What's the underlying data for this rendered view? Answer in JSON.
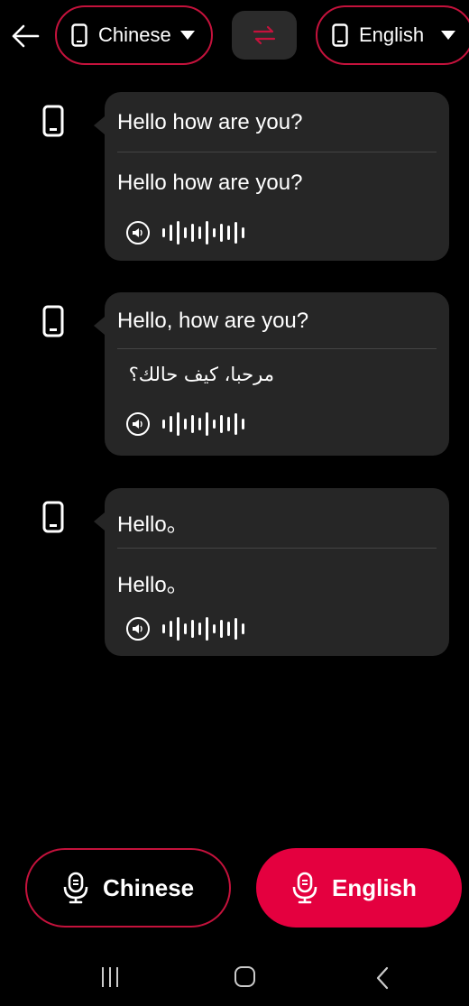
{
  "header": {
    "source_language": "Chinese",
    "target_language": "English",
    "back_icon": "arrow-left-icon",
    "swap_icon": "swap-arrows-icon",
    "accent_color": "#c4123c"
  },
  "messages": [
    {
      "source_text": "Hello how are you?",
      "translated_text": "Hello how are you?",
      "rtl": false
    },
    {
      "source_text": "Hello, how are you?",
      "translated_text": "مرحبا، كيف حالك؟",
      "rtl": true
    },
    {
      "source_text": "Hello。",
      "translated_text": "Hello。",
      "rtl": false
    }
  ],
  "bottom": {
    "source_button_label": "Chinese",
    "target_button_label": "English",
    "button_color": "#e4003f"
  },
  "navbar": {
    "icons": [
      "recent-apps-icon",
      "home-icon",
      "back-icon"
    ]
  }
}
